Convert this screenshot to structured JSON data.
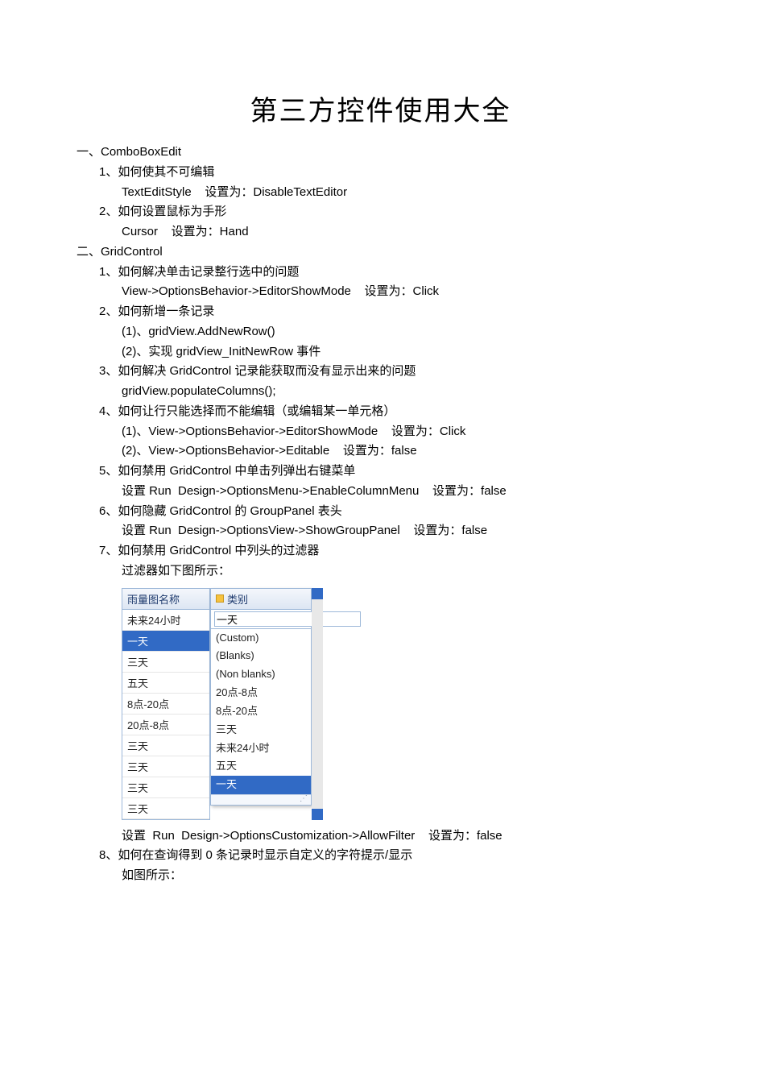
{
  "title": "第三方控件使用大全",
  "sections": [
    {
      "lvl": 0,
      "text": "一、ComboBoxEdit"
    },
    {
      "lvl": 1,
      "text": "1、如何使其不可编辑"
    },
    {
      "lvl": 2,
      "text": "TextEditStyle    设置为：DisableTextEditor"
    },
    {
      "lvl": 1,
      "text": "2、如何设置鼠标为手形"
    },
    {
      "lvl": 2,
      "text": "Cursor    设置为：Hand"
    },
    {
      "lvl": 0,
      "text": "二、GridControl"
    },
    {
      "lvl": 1,
      "text": "1、如何解决单击记录整行选中的问题"
    },
    {
      "lvl": 2,
      "text": "View->OptionsBehavior->EditorShowMode    设置为：Click"
    },
    {
      "lvl": 1,
      "text": "2、如何新增一条记录"
    },
    {
      "lvl": 2,
      "text": "(1)、gridView.AddNewRow()"
    },
    {
      "lvl": 2,
      "text": "(2)、实现 gridView_InitNewRow 事件"
    },
    {
      "lvl": 1,
      "text": "3、如何解决 GridControl 记录能获取而没有显示出来的问题"
    },
    {
      "lvl": 2,
      "text": "gridView.populateColumns();"
    },
    {
      "lvl": 1,
      "text": "4、如何让行只能选择而不能编辑（或编辑某一单元格）"
    },
    {
      "lvl": 2,
      "text": "(1)、View->OptionsBehavior->EditorShowMode    设置为：Click"
    },
    {
      "lvl": 2,
      "text": "(2)、View->OptionsBehavior->Editable    设置为：false"
    },
    {
      "lvl": 1,
      "text": "5、如何禁用 GridControl 中单击列弹出右键菜单"
    },
    {
      "lvl": 2,
      "text": "设置 Run  Design->OptionsMenu->EnableColumnMenu    设置为：false"
    },
    {
      "lvl": 1,
      "text": "6、如何隐藏 GridControl 的 GroupPanel 表头"
    },
    {
      "lvl": 2,
      "text": "设置 Run  Design->OptionsView->ShowGroupPanel    设置为：false"
    },
    {
      "lvl": 1,
      "text": "7、如何禁用 GridControl 中列头的过滤器"
    },
    {
      "lvl": 2,
      "text": "过滤器如下图所示："
    }
  ],
  "grid": {
    "left_header": "雨量图名称",
    "right_header": "类别",
    "filter_value": "一天",
    "left_rows": [
      {
        "text": "未来24小时",
        "selected": false
      },
      {
        "text": "一天",
        "selected": true
      },
      {
        "text": "三天",
        "selected": false
      },
      {
        "text": "五天",
        "selected": false
      },
      {
        "text": "8点-20点",
        "selected": false
      },
      {
        "text": "20点-8点",
        "selected": false
      },
      {
        "text": "三天",
        "selected": false
      },
      {
        "text": "三天",
        "selected": false
      },
      {
        "text": "三天",
        "selected": false
      },
      {
        "text": "三天",
        "selected": false
      }
    ],
    "filter_items": [
      {
        "text": "(Custom)",
        "selected": false
      },
      {
        "text": "(Blanks)",
        "selected": false
      },
      {
        "text": "(Non blanks)",
        "selected": false
      },
      {
        "text": "20点-8点",
        "selected": false
      },
      {
        "text": "8点-20点",
        "selected": false
      },
      {
        "text": "三天",
        "selected": false
      },
      {
        "text": "未来24小时",
        "selected": false
      },
      {
        "text": "五天",
        "selected": false
      },
      {
        "text": "一天",
        "selected": true
      }
    ]
  },
  "after_grid": [
    {
      "lvl": 2,
      "text": "设置  Run  Design->OptionsCustomization->AllowFilter    设置为：false"
    },
    {
      "lvl": 1,
      "text": "8、如何在查询得到 0 条记录时显示自定义的字符提示/显示"
    },
    {
      "lvl": 2,
      "text": "如图所示："
    }
  ]
}
